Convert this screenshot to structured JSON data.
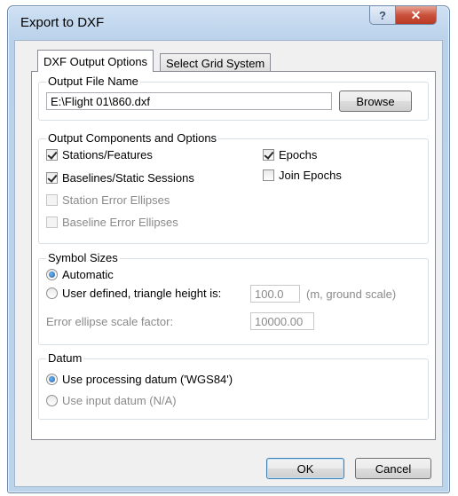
{
  "window": {
    "title": "Export to DXF",
    "help_label": "?",
    "close_label": "✕"
  },
  "tabs": [
    {
      "label": "DXF Output Options",
      "active": true
    },
    {
      "label": "Select Grid System",
      "active": false
    }
  ],
  "output_file": {
    "group_title": "Output File Name",
    "path_value": "E:\\Flight 01\\860.dxf",
    "browse_label": "Browse"
  },
  "components": {
    "group_title": "Output Components and Options",
    "stations": {
      "label": "Stations/Features",
      "checked": true
    },
    "baselines": {
      "label": "Baselines/Static Sessions",
      "checked": true
    },
    "station_error": {
      "label": "Station Error Ellipses",
      "checked": false,
      "disabled": true
    },
    "baseline_error": {
      "label": "Baseline Error Ellipses",
      "checked": false,
      "disabled": true
    },
    "epochs": {
      "label": "Epochs",
      "checked": true
    },
    "join_epochs": {
      "label": "Join Epochs",
      "checked": false
    }
  },
  "symbol_sizes": {
    "group_title": "Symbol Sizes",
    "automatic_label": "Automatic",
    "user_defined_label": "User defined, triangle height is:",
    "triangle_height_value": "100.0",
    "triangle_height_unit": "(m, ground scale)",
    "ellipse_factor_label": "Error ellipse scale factor:",
    "ellipse_factor_value": "10000.00",
    "selected": "Automatic"
  },
  "datum": {
    "group_title": "Datum",
    "processing_label": "Use processing datum ('WGS84')",
    "input_label": "Use input datum (N/A)",
    "selected": "processing"
  },
  "buttons": {
    "ok_label": "OK",
    "cancel_label": "Cancel"
  }
}
